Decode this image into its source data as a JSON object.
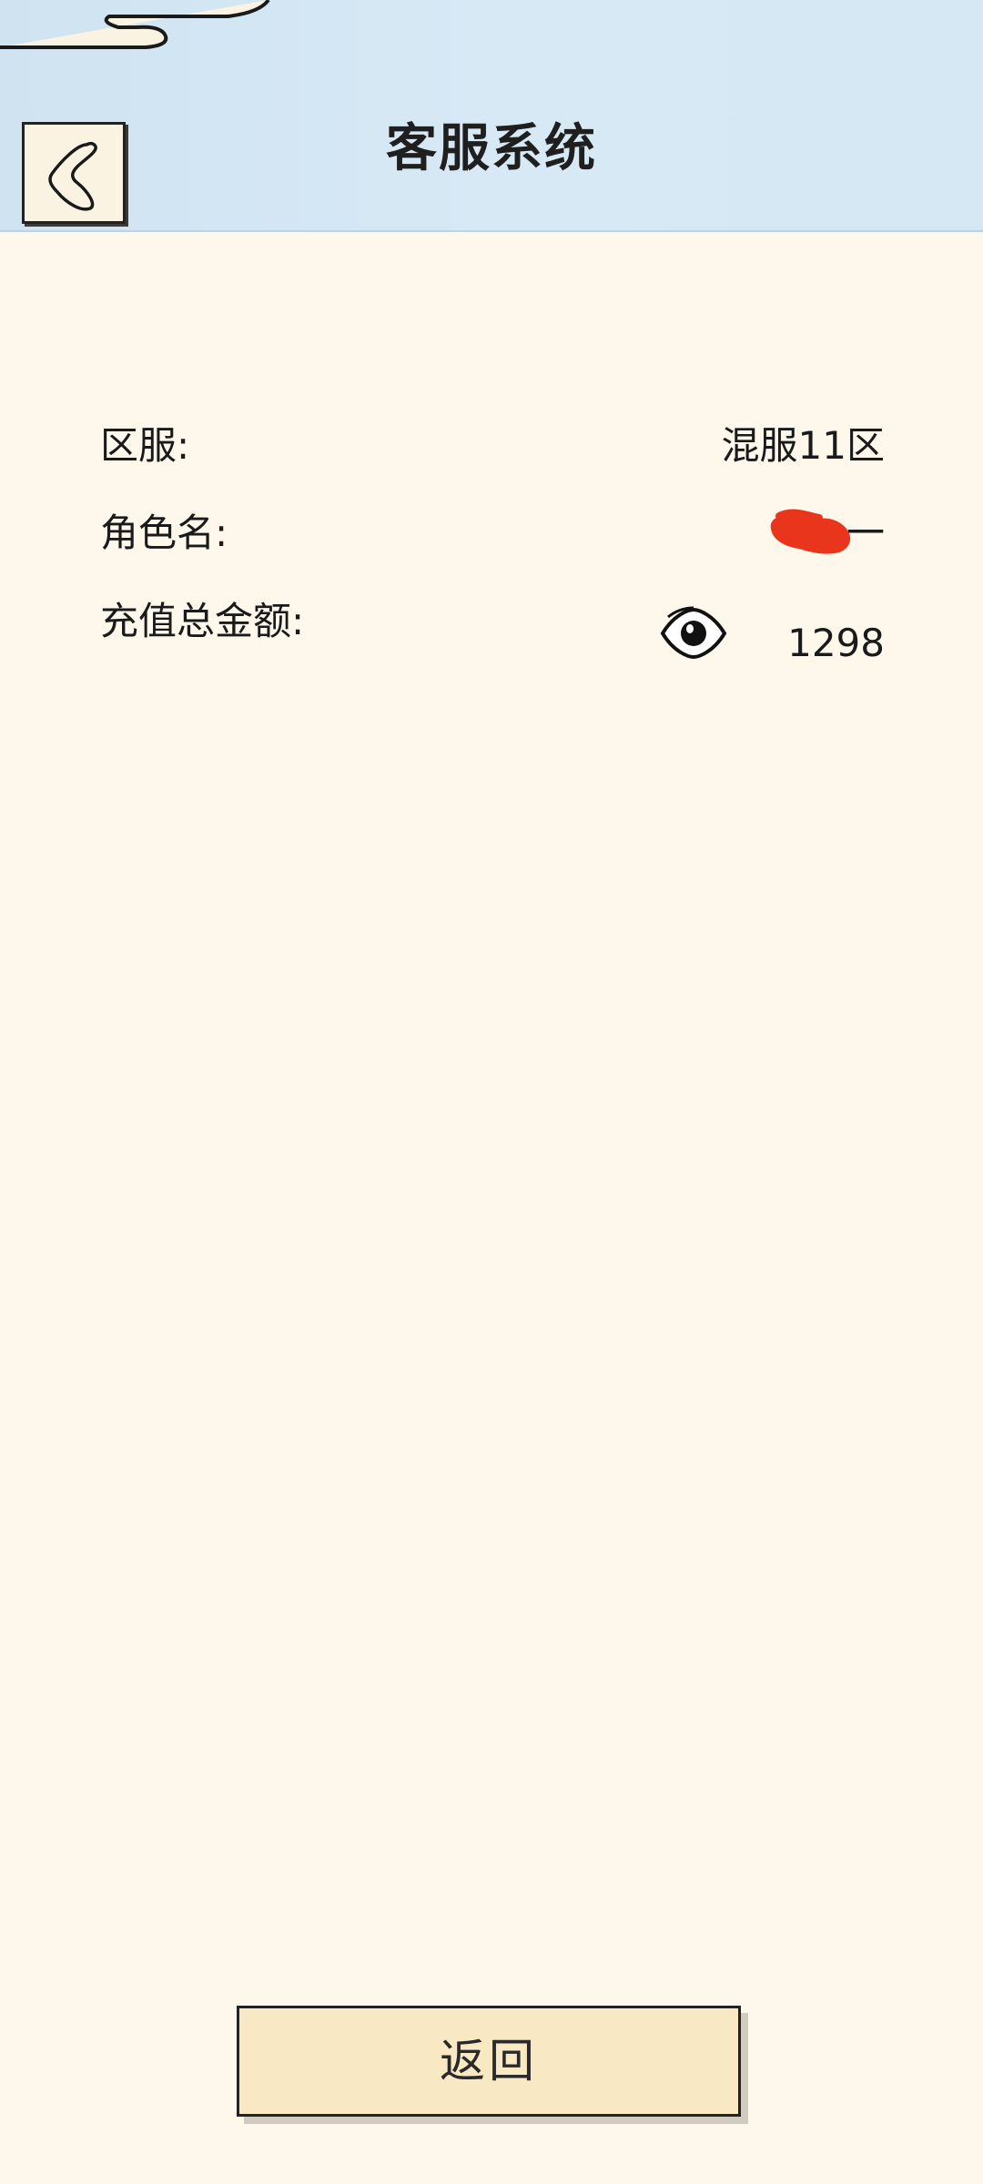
{
  "header": {
    "title": "客服系统",
    "back_icon": "chevron-left-icon"
  },
  "info": {
    "server_label": "区服:",
    "server_value": "混服11区",
    "name_label": "角色名:",
    "name_value": "一",
    "recharge_label": "充值总金额:",
    "recharge_value": "1298",
    "visibility_icon": "eye-icon"
  },
  "footer": {
    "return_label": "返回"
  },
  "colors": {
    "page_background": "#fdf7ec",
    "header_background": "#d7e9f5",
    "button_background": "#f8e8c3",
    "redaction": "#e8351c"
  }
}
